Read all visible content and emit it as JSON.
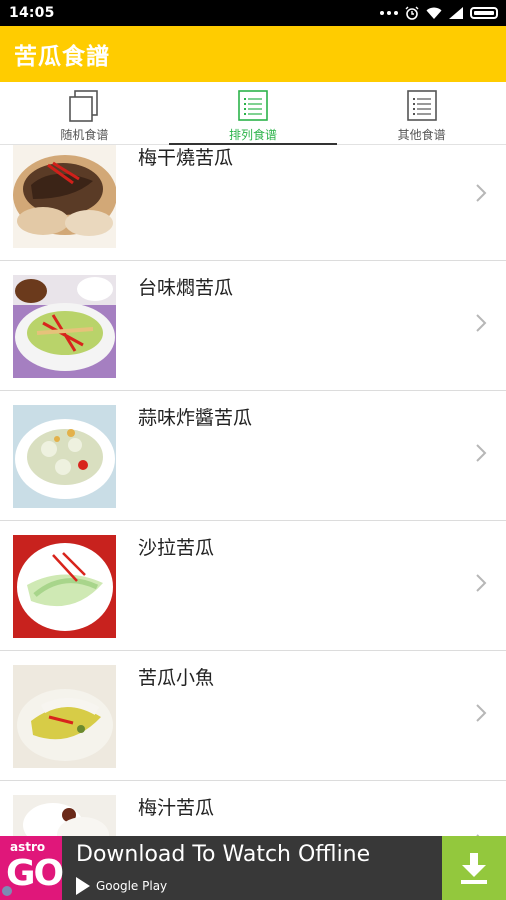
{
  "status_bar": {
    "time": "14:05"
  },
  "app_bar": {
    "title": "苦瓜食譜"
  },
  "tabs": [
    {
      "label": "随机食谱",
      "icon": "copy-icon",
      "active": false
    },
    {
      "label": "排列食谱",
      "icon": "list-icon",
      "active": true
    },
    {
      "label": "其他食谱",
      "icon": "list-icon",
      "active": false
    }
  ],
  "recipes": [
    {
      "title": "梅干燒苦瓜",
      "icon": "chevron-right-icon"
    },
    {
      "title": "台味燜苦瓜",
      "icon": "chevron-right-icon"
    },
    {
      "title": "蒜味炸醬苦瓜",
      "icon": "chevron-right-icon"
    },
    {
      "title": "沙拉苦瓜",
      "icon": "chevron-right-icon"
    },
    {
      "title": "苦瓜小魚",
      "icon": "chevron-right-icon"
    },
    {
      "title": "梅汁苦瓜",
      "icon": "chevron-right-icon"
    }
  ],
  "ad": {
    "brand_top": "astro",
    "brand_main": "GO",
    "headline": "Download To Watch Offline",
    "store": "Google Play"
  },
  "colors": {
    "app_bar": "#ffcc00",
    "active_tab": "#2cb34a",
    "ad_background": "#383838",
    "ad_logo": "#e0177a",
    "ad_download": "#93c83d"
  }
}
